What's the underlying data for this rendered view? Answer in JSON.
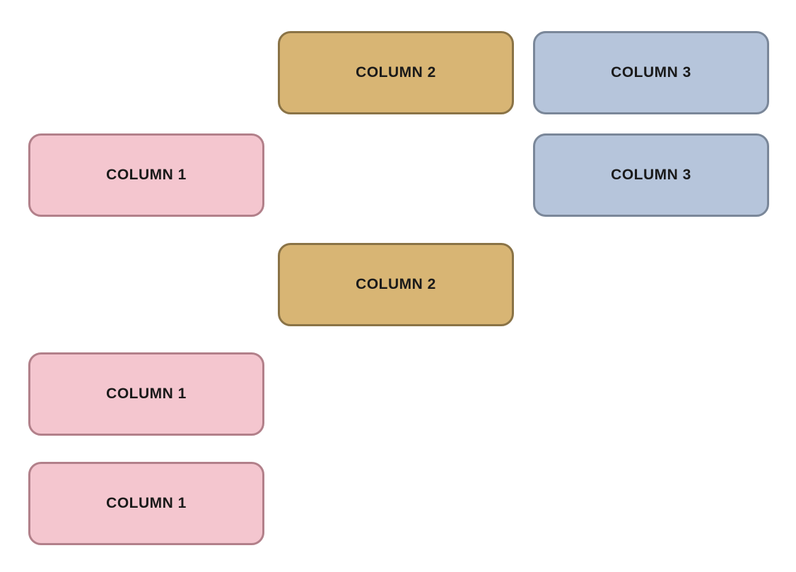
{
  "blocks": {
    "r1c2": {
      "label": "COLUMN 2"
    },
    "r1c3": {
      "label": "COLUMN 3"
    },
    "r2c1": {
      "label": "COLUMN 1"
    },
    "r2c3": {
      "label": "COLUMN 3"
    },
    "r3c2": {
      "label": "COLUMN 2"
    },
    "r4c1": {
      "label": "COLUMN 1"
    },
    "r5c1": {
      "label": "COLUMN 1"
    }
  },
  "colors": {
    "col1_fill": "#f4c6cf",
    "col1_border": "#b2808a",
    "col2_fill": "#d8b574",
    "col2_border": "#8a7346",
    "col3_fill": "#b6c5db",
    "col3_border": "#7a8799"
  }
}
